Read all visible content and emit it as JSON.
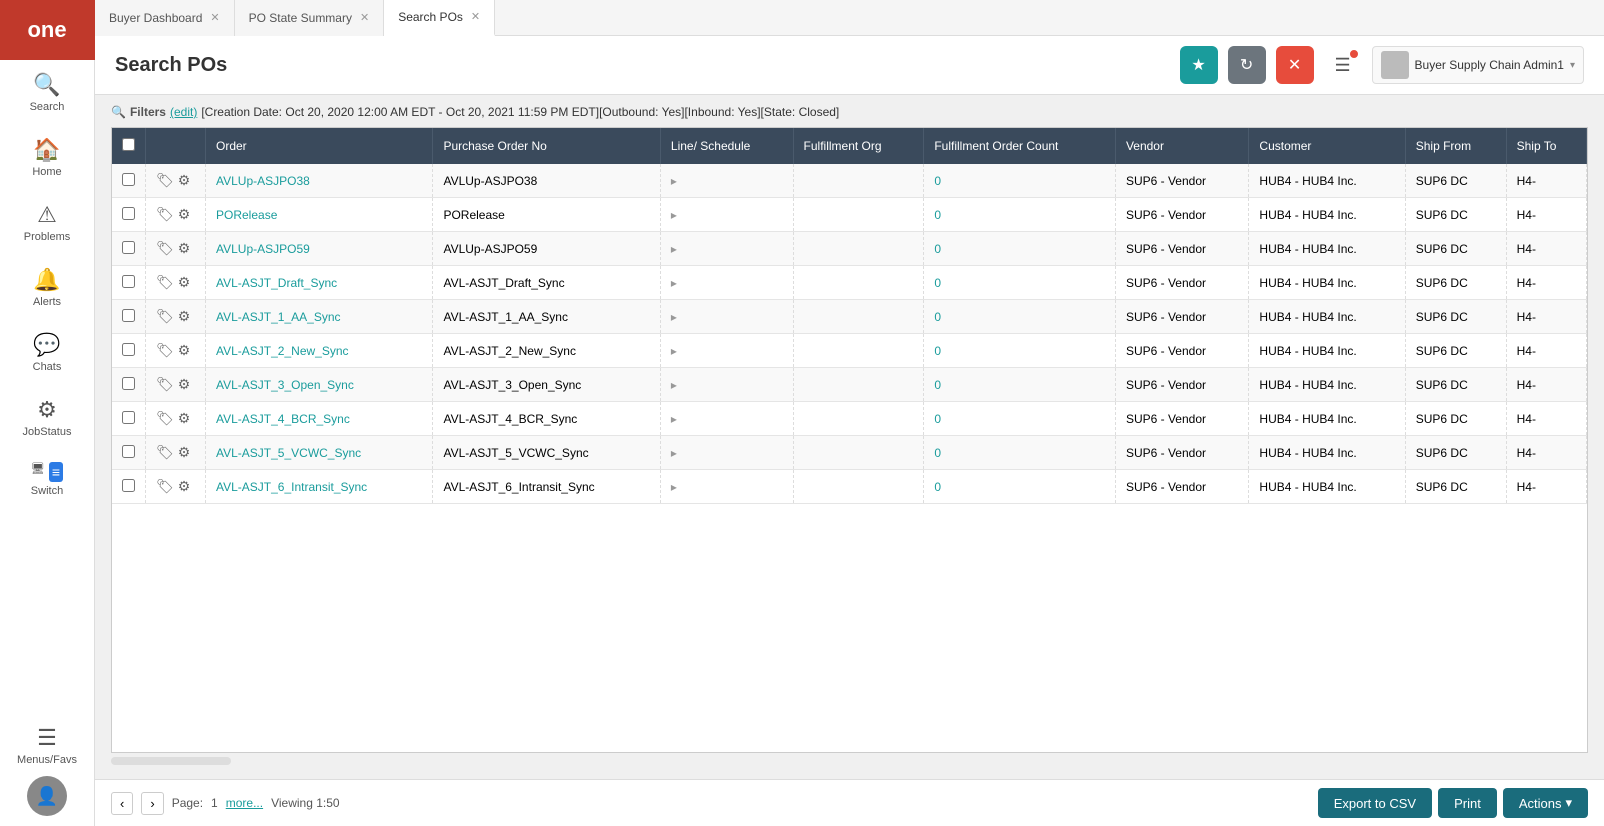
{
  "sidebar": {
    "logo": "one",
    "items": [
      {
        "id": "search",
        "label": "Search",
        "icon": "🔍"
      },
      {
        "id": "home",
        "label": "Home",
        "icon": "🏠"
      },
      {
        "id": "problems",
        "label": "Problems",
        "icon": "⚠"
      },
      {
        "id": "alerts",
        "label": "Alerts",
        "icon": "🔔"
      },
      {
        "id": "chats",
        "label": "Chats",
        "icon": "💬"
      },
      {
        "id": "jobstatus",
        "label": "JobStatus",
        "icon": "⚙"
      }
    ],
    "switch_label": "Switch",
    "menus_label": "Menus/Favs"
  },
  "tabs": [
    {
      "id": "buyer-dashboard",
      "label": "Buyer Dashboard",
      "active": false
    },
    {
      "id": "po-state-summary",
      "label": "PO State Summary",
      "active": false
    },
    {
      "id": "search-pos",
      "label": "Search POs",
      "active": true
    }
  ],
  "header": {
    "title": "Search POs",
    "star_btn": "★",
    "refresh_btn": "↻",
    "close_btn": "✕",
    "menu_btn": "☰",
    "user_name": "Buyer Supply Chain Admin1"
  },
  "filters": {
    "label": "Filters",
    "edit_label": "(edit)",
    "filter_text": "[Creation Date: Oct 20, 2020 12:00 AM EDT - Oct 20, 2021 11:59 PM EDT][Outbound: Yes][Inbound: Yes][State: Closed]"
  },
  "table": {
    "columns": [
      {
        "id": "checkbox",
        "label": ""
      },
      {
        "id": "icons",
        "label": ""
      },
      {
        "id": "order",
        "label": "Order"
      },
      {
        "id": "po_no",
        "label": "Purchase Order No"
      },
      {
        "id": "line_schedule",
        "label": "Line/ Schedule"
      },
      {
        "id": "fulfillment_org",
        "label": "Fulfillment Org"
      },
      {
        "id": "fulfillment_order_count",
        "label": "Fulfillment Order Count"
      },
      {
        "id": "vendor",
        "label": "Vendor"
      },
      {
        "id": "customer",
        "label": "Customer"
      },
      {
        "id": "ship_from",
        "label": "Ship From"
      },
      {
        "id": "ship_to",
        "label": "Ship To"
      }
    ],
    "rows": [
      {
        "order": "AVLUp-ASJPO38",
        "po_no": "AVLUp-ASJPO38",
        "line_schedule": "▸",
        "fulfillment_org": "",
        "fulfillment_order_count": "0",
        "vendor": "SUP6 - Vendor",
        "customer": "HUB4 - HUB4 Inc.",
        "ship_from": "SUP6 DC",
        "ship_to": "H4-"
      },
      {
        "order": "PORelease",
        "po_no": "PORelease",
        "line_schedule": "▸",
        "fulfillment_org": "",
        "fulfillment_order_count": "0",
        "vendor": "SUP6 - Vendor",
        "customer": "HUB4 - HUB4 Inc.",
        "ship_from": "SUP6 DC",
        "ship_to": "H4-"
      },
      {
        "order": "AVLUp-ASJPO59",
        "po_no": "AVLUp-ASJPO59",
        "line_schedule": "▸",
        "fulfillment_org": "",
        "fulfillment_order_count": "0",
        "vendor": "SUP6 - Vendor",
        "customer": "HUB4 - HUB4 Inc.",
        "ship_from": "SUP6 DC",
        "ship_to": "H4-"
      },
      {
        "order": "AVL-ASJT_Draft_Sync",
        "po_no": "AVL-ASJT_Draft_Sync",
        "line_schedule": "▸",
        "fulfillment_org": "",
        "fulfillment_order_count": "0",
        "vendor": "SUP6 - Vendor",
        "customer": "HUB4 - HUB4 Inc.",
        "ship_from": "SUP6 DC",
        "ship_to": "H4-"
      },
      {
        "order": "AVL-ASJT_1_AA_Sync",
        "po_no": "AVL-ASJT_1_AA_Sync",
        "line_schedule": "▸",
        "fulfillment_org": "",
        "fulfillment_order_count": "0",
        "vendor": "SUP6 - Vendor",
        "customer": "HUB4 - HUB4 Inc.",
        "ship_from": "SUP6 DC",
        "ship_to": "H4-"
      },
      {
        "order": "AVL-ASJT_2_New_Sync",
        "po_no": "AVL-ASJT_2_New_Sync",
        "line_schedule": "▸",
        "fulfillment_org": "",
        "fulfillment_order_count": "0",
        "vendor": "SUP6 - Vendor",
        "customer": "HUB4 - HUB4 Inc.",
        "ship_from": "SUP6 DC",
        "ship_to": "H4-"
      },
      {
        "order": "AVL-ASJT_3_Open_Sync",
        "po_no": "AVL-ASJT_3_Open_Sync",
        "line_schedule": "▸",
        "fulfillment_org": "",
        "fulfillment_order_count": "0",
        "vendor": "SUP6 - Vendor",
        "customer": "HUB4 - HUB4 Inc.",
        "ship_from": "SUP6 DC",
        "ship_to": "H4-"
      },
      {
        "order": "AVL-ASJT_4_BCR_Sync",
        "po_no": "AVL-ASJT_4_BCR_Sync",
        "line_schedule": "▸",
        "fulfillment_org": "",
        "fulfillment_order_count": "0",
        "vendor": "SUP6 - Vendor",
        "customer": "HUB4 - HUB4 Inc.",
        "ship_from": "SUP6 DC",
        "ship_to": "H4-"
      },
      {
        "order": "AVL-ASJT_5_VCWC_Sync",
        "po_no": "AVL-ASJT_5_VCWC_Sync",
        "line_schedule": "▸",
        "fulfillment_org": "",
        "fulfillment_order_count": "0",
        "vendor": "SUP6 - Vendor",
        "customer": "HUB4 - HUB4 Inc.",
        "ship_from": "SUP6 DC",
        "ship_to": "H4-"
      },
      {
        "order": "AVL-ASJT_6_Intransit_Sync",
        "po_no": "AVL-ASJT_6_Intransit_Sync",
        "line_schedule": "▸",
        "fulfillment_org": "",
        "fulfillment_order_count": "0",
        "vendor": "SUP6 - Vendor",
        "customer": "HUB4 - HUB4 Inc.",
        "ship_from": "SUP6 DC",
        "ship_to": "H4-"
      }
    ]
  },
  "footer": {
    "prev_label": "‹",
    "next_label": "›",
    "page_label": "Page:",
    "page_num": "1",
    "more_label": "more...",
    "viewing_label": "Viewing 1:50",
    "export_label": "Export to CSV",
    "print_label": "Print",
    "actions_label": "Actions",
    "actions_chevron": "▾"
  },
  "colors": {
    "teal": "#1a9c9c",
    "header_bg": "#3a4a5c",
    "red": "#c0392b",
    "dark_teal": "#1a6c7c"
  }
}
